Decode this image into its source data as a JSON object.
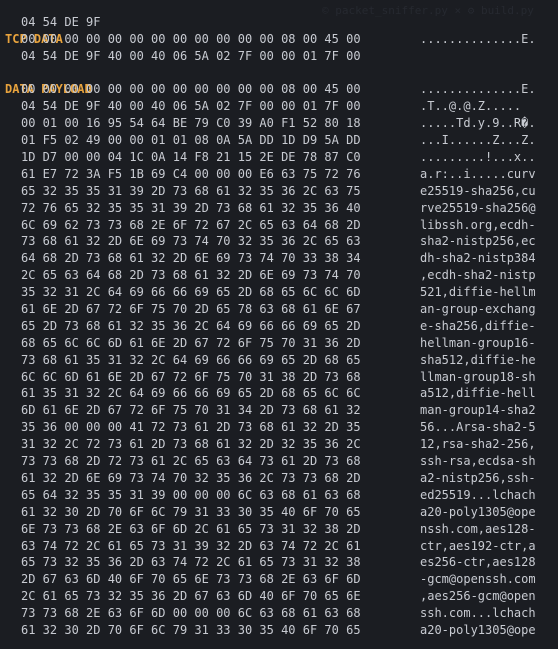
{
  "background_ghost": "© packet_sniffer.py × ⚙ build.py",
  "colors": {
    "background": "#1b1d22",
    "text": "#c8cbd2",
    "section_header": "#e8a33d"
  },
  "top_fragment": "04 54 DE 9F",
  "tcp_section": {
    "title": "TCP DATA",
    "rows": [
      {
        "hex": "00 00 00 00 00 00 00 00 00 00 00 00 08 00 45 00",
        "ascii": "..............E."
      },
      {
        "hex": "04 54 DE 9F 40 00 40 06 5A 02 7F 00 00 01 7F 00",
        "ascii": ""
      }
    ]
  },
  "payload_section": {
    "title": "DATA PAYLOAD",
    "rows": [
      {
        "hex": "00 00 00 00 00 00 00 00 00 00 00 00 08 00 45 00",
        "ascii": "..............E."
      },
      {
        "hex": "04 54 DE 9F 40 00 40 06 5A 02 7F 00 00 01 7F 00",
        "ascii": ".T..@.@.Z....."
      },
      {
        "hex": "00 01 00 16 95 54 64 BE 79 C0 39 A0 F1 52 80 18",
        "ascii": ".....Td.y.9..R�."
      },
      {
        "hex": "01 F5 02 49 00 00 01 01 08 0A 5A DD 1D D9 5A DD",
        "ascii": "...I......Z...Z."
      },
      {
        "hex": "1D D7 00 00 04 1C 0A 14 F8 21 15 2E DE 78 87 C0",
        "ascii": ".........!...x.."
      },
      {
        "hex": "61 E7 72 3A F5 1B 69 C4 00 00 00 E6 63 75 72 76",
        "ascii": "a.r:..i.....curv"
      },
      {
        "hex": "65 32 35 35 31 39 2D 73 68 61 32 35 36 2C 63 75",
        "ascii": "e25519-sha256,cu"
      },
      {
        "hex": "72 76 65 32 35 35 31 39 2D 73 68 61 32 35 36 40",
        "ascii": "rve25519-sha256@"
      },
      {
        "hex": "6C 69 62 73 73 68 2E 6F 72 67 2C 65 63 64 68 2D",
        "ascii": "libssh.org,ecdh-"
      },
      {
        "hex": "73 68 61 32 2D 6E 69 73 74 70 32 35 36 2C 65 63",
        "ascii": "sha2-nistp256,ec"
      },
      {
        "hex": "64 68 2D 73 68 61 32 2D 6E 69 73 74 70 33 38 34",
        "ascii": "dh-sha2-nistp384"
      },
      {
        "hex": "2C 65 63 64 68 2D 73 68 61 32 2D 6E 69 73 74 70",
        "ascii": ",ecdh-sha2-nistp"
      },
      {
        "hex": "35 32 31 2C 64 69 66 66 69 65 2D 68 65 6C 6C 6D",
        "ascii": "521,diffie-hellm"
      },
      {
        "hex": "61 6E 2D 67 72 6F 75 70 2D 65 78 63 68 61 6E 67",
        "ascii": "an-group-exchang"
      },
      {
        "hex": "65 2D 73 68 61 32 35 36 2C 64 69 66 66 69 65 2D",
        "ascii": "e-sha256,diffie-"
      },
      {
        "hex": "68 65 6C 6C 6D 61 6E 2D 67 72 6F 75 70 31 36 2D",
        "ascii": "hellman-group16-"
      },
      {
        "hex": "73 68 61 35 31 32 2C 64 69 66 66 69 65 2D 68 65",
        "ascii": "sha512,diffie-he"
      },
      {
        "hex": "6C 6C 6D 61 6E 2D 67 72 6F 75 70 31 38 2D 73 68",
        "ascii": "llman-group18-sh"
      },
      {
        "hex": "61 35 31 32 2C 64 69 66 66 69 65 2D 68 65 6C 6C",
        "ascii": "a512,diffie-hell"
      },
      {
        "hex": "6D 61 6E 2D 67 72 6F 75 70 31 34 2D 73 68 61 32",
        "ascii": "man-group14-sha2"
      },
      {
        "hex": "35 36 00 00 00 41 72 73 61 2D 73 68 61 32 2D 35",
        "ascii": "56...Arsa-sha2-5"
      },
      {
        "hex": "31 32 2C 72 73 61 2D 73 68 61 32 2D 32 35 36 2C",
        "ascii": "12,rsa-sha2-256,"
      },
      {
        "hex": "73 73 68 2D 72 73 61 2C 65 63 64 73 61 2D 73 68",
        "ascii": "ssh-rsa,ecdsa-sh"
      },
      {
        "hex": "61 32 2D 6E 69 73 74 70 32 35 36 2C 73 73 68 2D",
        "ascii": "a2-nistp256,ssh-"
      },
      {
        "hex": "65 64 32 35 35 31 39 00 00 00 6C 63 68 61 63 68",
        "ascii": "ed25519...lchach"
      },
      {
        "hex": "61 32 30 2D 70 6F 6C 79 31 33 30 35 40 6F 70 65",
        "ascii": "a20-poly1305@ope"
      },
      {
        "hex": "6E 73 73 68 2E 63 6F 6D 2C 61 65 73 31 32 38 2D",
        "ascii": "nssh.com,aes128-"
      },
      {
        "hex": "63 74 72 2C 61 65 73 31 39 32 2D 63 74 72 2C 61",
        "ascii": "ctr,aes192-ctr,a"
      },
      {
        "hex": "65 73 32 35 36 2D 63 74 72 2C 61 65 73 31 32 38",
        "ascii": "es256-ctr,aes128"
      },
      {
        "hex": "2D 67 63 6D 40 6F 70 65 6E 73 73 68 2E 63 6F 6D",
        "ascii": "-gcm@openssh.com"
      },
      {
        "hex": "2C 61 65 73 32 35 36 2D 67 63 6D 40 6F 70 65 6E",
        "ascii": ",aes256-gcm@open"
      },
      {
        "hex": "73 73 68 2E 63 6F 6D 00 00 00 6C 63 68 61 63 68",
        "ascii": "ssh.com...lchach"
      },
      {
        "hex": "61 32 30 2D 70 6F 6C 79 31 33 30 35 40 6F 70 65",
        "ascii": "a20-poly1305@ope"
      }
    ]
  }
}
